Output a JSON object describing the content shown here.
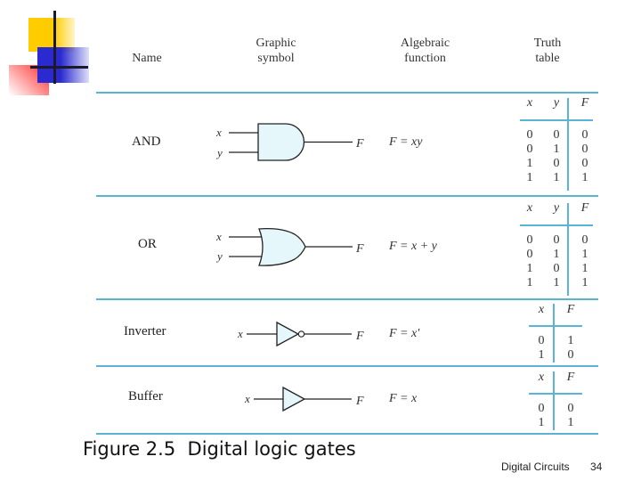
{
  "header": {
    "name": "Name",
    "graphic_symbol": [
      "Graphic",
      "symbol"
    ],
    "algebraic_function": [
      "Algebraic",
      "function"
    ],
    "truth_table": [
      "Truth",
      "table"
    ]
  },
  "gates": [
    {
      "name": "AND",
      "symbol": "and-gate",
      "inputs": [
        "x",
        "y"
      ],
      "output": "F",
      "function": "F = xy",
      "truth_table": {
        "columns": [
          "x",
          "y",
          "F"
        ],
        "rows": [
          [
            "0",
            "0",
            "0"
          ],
          [
            "0",
            "1",
            "0"
          ],
          [
            "1",
            "0",
            "0"
          ],
          [
            "1",
            "1",
            "1"
          ]
        ]
      }
    },
    {
      "name": "OR",
      "symbol": "or-gate",
      "inputs": [
        "x",
        "y"
      ],
      "output": "F",
      "function": "F = x + y",
      "truth_table": {
        "columns": [
          "x",
          "y",
          "F"
        ],
        "rows": [
          [
            "0",
            "0",
            "0"
          ],
          [
            "0",
            "1",
            "1"
          ],
          [
            "1",
            "0",
            "1"
          ],
          [
            "1",
            "1",
            "1"
          ]
        ]
      }
    },
    {
      "name": "Inverter",
      "symbol": "not-gate",
      "inputs": [
        "x"
      ],
      "output": "F",
      "function": "F = x′",
      "truth_table": {
        "columns": [
          "x",
          "F"
        ],
        "rows": [
          [
            "0",
            "1"
          ],
          [
            "1",
            "0"
          ]
        ]
      }
    },
    {
      "name": "Buffer",
      "symbol": "buffer-gate",
      "inputs": [
        "x"
      ],
      "output": "F",
      "function": "F = x",
      "truth_table": {
        "columns": [
          "x",
          "F"
        ],
        "rows": [
          [
            "0",
            "0"
          ],
          [
            "1",
            "1"
          ]
        ]
      }
    }
  ],
  "caption": "Figure 2.5  Digital logic gates",
  "footer": {
    "title": "Digital Circuits",
    "page": "34"
  },
  "colors": {
    "rule": "#5ab4d6",
    "gate_fill": "#e6f7fb",
    "gate_stroke": "#222222"
  }
}
